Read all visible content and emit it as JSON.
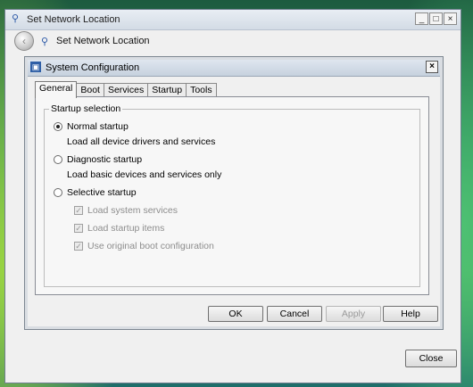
{
  "outer_window": {
    "title": "Set Network Location",
    "nav_title": "Set Network Location",
    "close_label": "Close",
    "window_buttons": [
      "_",
      "□",
      "×"
    ]
  },
  "dialog": {
    "title": "System Configuration",
    "close_glyph": "×",
    "tabs": [
      "General",
      "Boot",
      "Services",
      "Startup",
      "Tools"
    ],
    "active_tab": "General",
    "group_title": "Startup selection",
    "options": [
      {
        "label": "Normal startup",
        "desc": "Load all device drivers and services",
        "checked": true
      },
      {
        "label": "Diagnostic startup",
        "desc": "Load basic devices and services only",
        "checked": false
      },
      {
        "label": "Selective startup",
        "desc": "",
        "checked": false
      }
    ],
    "selective_items": [
      "Load system services",
      "Load startup items",
      "Use original boot configuration"
    ],
    "buttons": {
      "ok": "OK",
      "cancel": "Cancel",
      "apply": "Apply",
      "help": "Help"
    }
  }
}
